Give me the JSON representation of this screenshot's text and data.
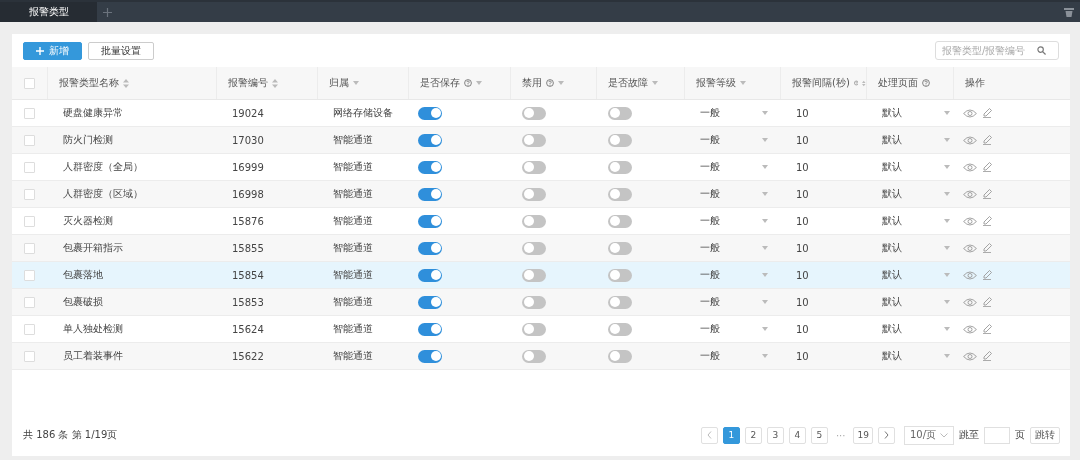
{
  "tabs": [
    {
      "label": "报警类型",
      "selected": true
    }
  ],
  "toolbar": {
    "buttons": [
      "新增",
      "批量设置"
    ],
    "search": {
      "placeholder": "报警类型/报警编号"
    }
  },
  "table": {
    "columns": [
      {
        "label": "报警类型名称",
        "sort": true,
        "filter": false,
        "help": false
      },
      {
        "label": "报警编号",
        "sort": true,
        "filter": false,
        "help": false
      },
      {
        "label": "归属",
        "sort": false,
        "filter": true,
        "help": false
      },
      {
        "label": "是否保存",
        "sort": false,
        "filter": true,
        "help": true
      },
      {
        "label": "禁用",
        "sort": false,
        "filter": true,
        "help": true
      },
      {
        "label": "是否故障",
        "sort": false,
        "filter": true,
        "help": false
      },
      {
        "label": "报警等级",
        "sort": false,
        "filter": true,
        "help": false
      },
      {
        "label": "报警间隔(秒)",
        "sort": true,
        "filter": false,
        "help": true
      },
      {
        "label": "处理页面",
        "sort": false,
        "filter": false,
        "help": true
      },
      {
        "label": "操作",
        "sort": false,
        "filter": false,
        "help": false
      }
    ],
    "select_all": {
      "checked": false
    },
    "rows": [
      {
        "checked": false,
        "name": "硬盘健康异常",
        "code": "19024",
        "owner": "网络存储设备",
        "save": true,
        "disabled": false,
        "fault": false,
        "level": "一般",
        "interval": "10",
        "page": "默认",
        "selected": false
      },
      {
        "checked": false,
        "name": "防火门检测",
        "code": "17030",
        "owner": "智能通道",
        "save": true,
        "disabled": false,
        "fault": false,
        "level": "一般",
        "interval": "10",
        "page": "默认",
        "selected": false
      },
      {
        "checked": false,
        "name": "人群密度（全局）",
        "code": "16999",
        "owner": "智能通道",
        "save": true,
        "disabled": false,
        "fault": false,
        "level": "一般",
        "interval": "10",
        "page": "默认",
        "selected": false
      },
      {
        "checked": false,
        "name": "人群密度（区域）",
        "code": "16998",
        "owner": "智能通道",
        "save": true,
        "disabled": false,
        "fault": false,
        "level": "一般",
        "interval": "10",
        "page": "默认",
        "selected": false
      },
      {
        "checked": false,
        "name": "灭火器检测",
        "code": "15876",
        "owner": "智能通道",
        "save": true,
        "disabled": false,
        "fault": false,
        "level": "一般",
        "interval": "10",
        "page": "默认",
        "selected": false
      },
      {
        "checked": false,
        "name": "包裹开箱指示",
        "code": "15855",
        "owner": "智能通道",
        "save": true,
        "disabled": false,
        "fault": false,
        "level": "一般",
        "interval": "10",
        "page": "默认",
        "selected": false
      },
      {
        "checked": false,
        "name": "包裹落地",
        "code": "15854",
        "owner": "智能通道",
        "save": true,
        "disabled": false,
        "fault": false,
        "level": "一般",
        "interval": "10",
        "page": "默认",
        "selected": true
      },
      {
        "checked": false,
        "name": "包裹破损",
        "code": "15853",
        "owner": "智能通道",
        "save": true,
        "disabled": false,
        "fault": false,
        "level": "一般",
        "interval": "10",
        "page": "默认",
        "selected": false
      },
      {
        "checked": false,
        "name": "单人独处检测",
        "code": "15624",
        "owner": "智能通道",
        "save": true,
        "disabled": false,
        "fault": false,
        "level": "一般",
        "interval": "10",
        "page": "默认",
        "selected": false
      },
      {
        "checked": false,
        "name": "员工着装事件",
        "code": "15622",
        "owner": "智能通道",
        "save": true,
        "disabled": false,
        "fault": false,
        "level": "一般",
        "interval": "10",
        "page": "默认",
        "selected": false
      }
    ]
  },
  "footer": {
    "summary": "共 186 条 第 1/19页",
    "pages": [
      {
        "label": "1",
        "selected": true
      },
      {
        "label": "2",
        "selected": false
      },
      {
        "label": "3",
        "selected": false
      },
      {
        "label": "4",
        "selected": false
      },
      {
        "label": "5",
        "selected": false
      },
      {
        "label": "19",
        "selected": false
      }
    ],
    "ellipsis": "···",
    "page_size": "10/页",
    "jump_label": "跳至",
    "page_unit": "页",
    "jump_button": "跳转"
  }
}
